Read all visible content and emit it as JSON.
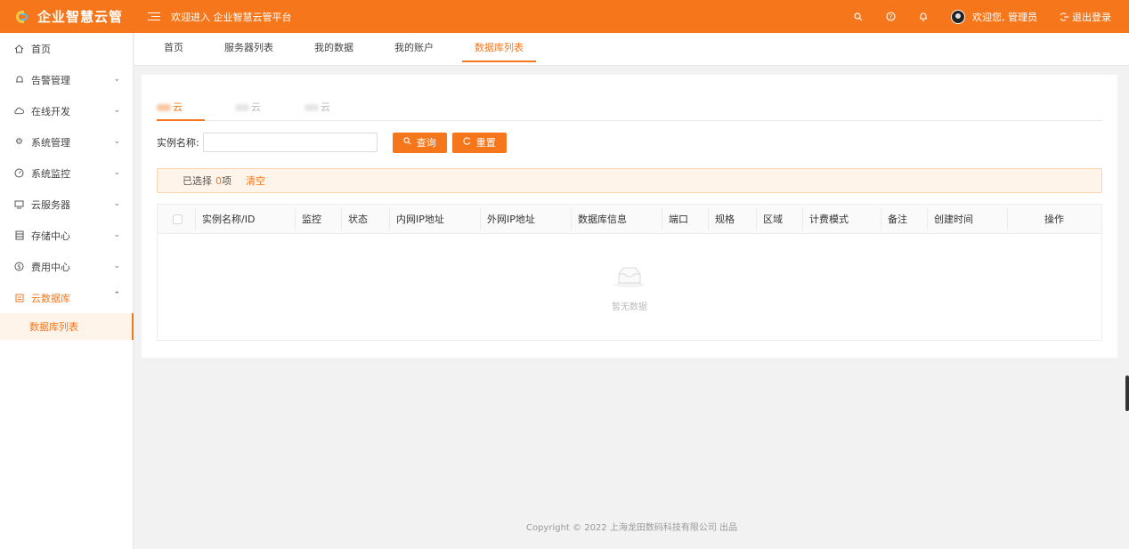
{
  "brand": {
    "name": "企业智慧云管"
  },
  "header": {
    "welcome": "欢迎进入 企业智慧云管平台",
    "user_greeting": "欢迎您, 管理员",
    "logout": "退出登录"
  },
  "sidebar": {
    "items": [
      {
        "label": "首页",
        "icon": "home-icon"
      },
      {
        "label": "告警管理",
        "icon": "bell-icon"
      },
      {
        "label": "在线开发",
        "icon": "cloud-icon"
      },
      {
        "label": "系统管理",
        "icon": "gear-icon"
      },
      {
        "label": "系统监控",
        "icon": "gauge-icon"
      },
      {
        "label": "云服务器",
        "icon": "monitor-icon"
      },
      {
        "label": "存储中心",
        "icon": "storage-icon"
      },
      {
        "label": "费用中心",
        "icon": "dollar-icon"
      },
      {
        "label": "云数据库",
        "icon": "database-icon"
      }
    ],
    "sub_item": "数据库列表"
  },
  "tabs": [
    "首页",
    "服务器列表",
    "我的数据",
    "我的账户",
    "数据库列表"
  ],
  "cloud_tabs": [
    "云",
    "云",
    "云"
  ],
  "search": {
    "label": "实例名称:",
    "value": "",
    "placeholder": "",
    "query_label": "查询",
    "reset_label": "重置"
  },
  "selection": {
    "prefix": "已选择",
    "count": "0",
    "suffix": "项",
    "clear": "清空"
  },
  "table": {
    "columns": [
      "实例名称/ID",
      "监控",
      "状态",
      "内网IP地址",
      "外网IP地址",
      "数据库信息",
      "端口",
      "规格",
      "区域",
      "计费模式",
      "备注",
      "创建时间",
      "操作"
    ],
    "empty_text": "暂无数据"
  },
  "footer": {
    "copyright": "Copyright © 2022 上海龙田数码科技有限公司 出品"
  },
  "colors": {
    "accent": "#f5761b",
    "sidebar_bg": "#ffffff",
    "page_bg": "#f2f2f2"
  }
}
